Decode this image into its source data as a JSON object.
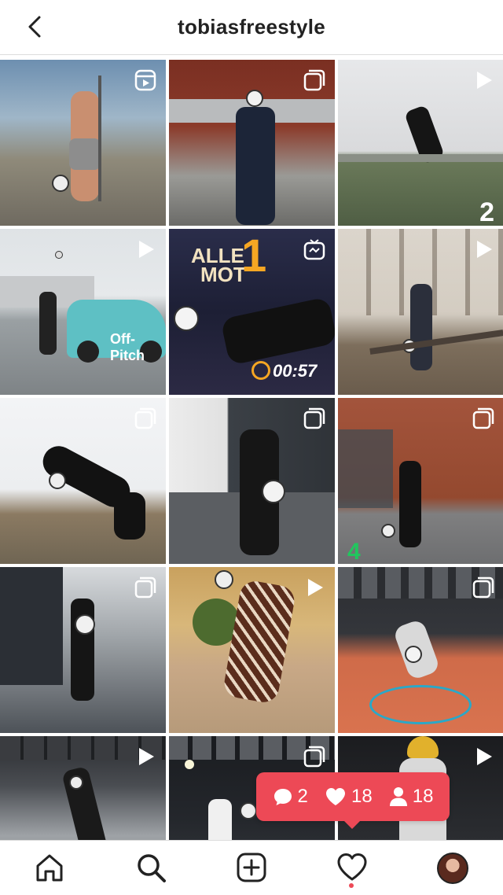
{
  "header": {
    "title": "tobiasfreestyle",
    "back_icon": "chevron-left-icon"
  },
  "grid": {
    "tiles": [
      {
        "row": 1,
        "col": 1,
        "badge": "reel-icon",
        "scene": "outdoor court, shirtless player juggling"
      },
      {
        "row": 1,
        "col": 2,
        "badge": "carousel-icon",
        "scene": "brick building, player with ball on chest"
      },
      {
        "row": 1,
        "col": 3,
        "badge": "video-icon",
        "scene": "grass field, player kicking",
        "overlay_text": "2"
      },
      {
        "row": 2,
        "col": 1,
        "badge": "video-icon",
        "scene": "parking lot, car",
        "overlay_text": "Off-Pitch"
      },
      {
        "row": 2,
        "col": 2,
        "badge": "igtv-icon",
        "scene": "studio with timer",
        "overlay_text_1": "ALLE",
        "overlay_text_2": "MOT",
        "overlay_text_3": "1",
        "timer": "00:57"
      },
      {
        "row": 2,
        "col": 3,
        "badge": "video-icon",
        "scene": "stairs, player with ball"
      },
      {
        "row": 3,
        "col": 1,
        "badge": "carousel-icon",
        "scene": "bicycle kick"
      },
      {
        "row": 3,
        "col": 2,
        "badge": "carousel-icon",
        "scene": "player holding ball"
      },
      {
        "row": 3,
        "col": 3,
        "badge": "carousel-icon",
        "scene": "brick building, player",
        "overlay_text": "4"
      },
      {
        "row": 4,
        "col": 1,
        "badge": "carousel-icon",
        "scene": "wet street, player"
      },
      {
        "row": 4,
        "col": 2,
        "badge": "video-icon",
        "scene": "handstand, patterned outfit"
      },
      {
        "row": 4,
        "col": 3,
        "badge": "carousel-icon",
        "scene": "indoor court"
      },
      {
        "row": 5,
        "col": 1,
        "badge": "video-icon",
        "scene": "indoor gym"
      },
      {
        "row": 5,
        "col": 2,
        "badge": "carousel-icon",
        "scene": "dark studio"
      },
      {
        "row": 5,
        "col": 3,
        "badge": "video-icon",
        "scene": "yellow beanie player"
      }
    ]
  },
  "activity": {
    "comments": "2",
    "likes": "18",
    "followers": "18",
    "color": "#ed4956"
  },
  "tabbar": {
    "items": [
      "home-icon",
      "search-icon",
      "add-icon",
      "heart-icon",
      "profile-avatar"
    ]
  }
}
